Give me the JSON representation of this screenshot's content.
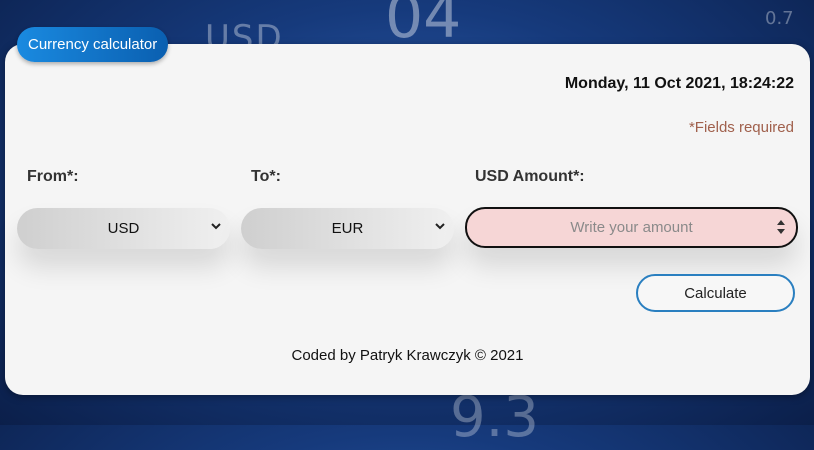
{
  "app": {
    "title": "Currency calculator"
  },
  "header": {
    "datetime": "Monday, 11 Oct 2021, 18:24:22",
    "required_note": "*Fields required"
  },
  "form": {
    "from_label": "From*:",
    "from_value": "USD",
    "to_label": "To*:",
    "to_value": "EUR",
    "amount_label": "USD Amount*:",
    "amount_placeholder": "Write your amount",
    "amount_value": "",
    "calculate_label": "Calculate"
  },
  "footer": {
    "text": "Coded by Patryk Krawczyk © 2021"
  },
  "colors": {
    "accent": "#1a8ae0",
    "amount_field_bg": "#f6d6d6",
    "required_text": "#a0604c",
    "card_bg": "#f5f5f5"
  },
  "icons": {
    "from_dropdown": "chevron-down-icon",
    "to_dropdown": "chevron-down-icon",
    "amount_spinner": "spinner-arrows-icon"
  }
}
